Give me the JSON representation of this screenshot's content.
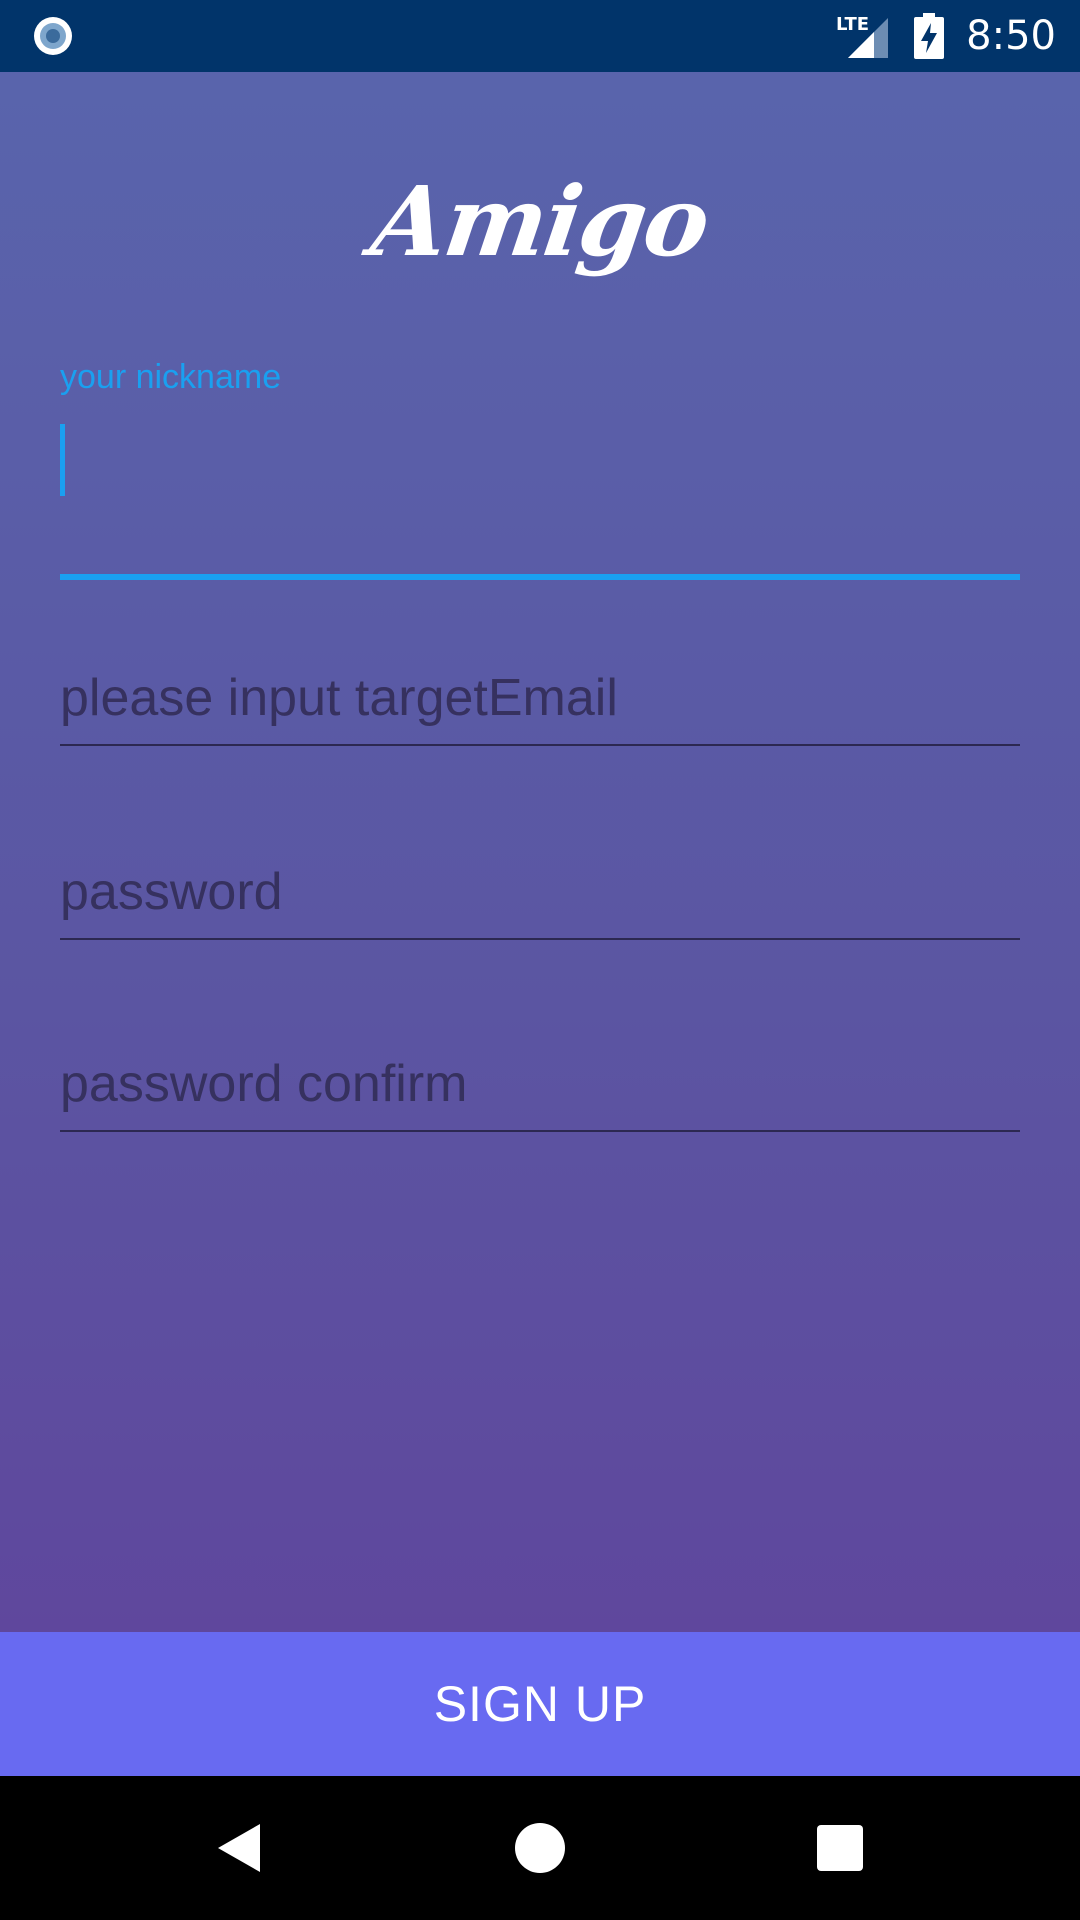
{
  "status_bar": {
    "time": "8:50",
    "network_label": "LTE",
    "icons": [
      "status-circle-icon",
      "lte-signal-icon",
      "battery-charging-icon"
    ],
    "background": "#01346a"
  },
  "app": {
    "logo_text": "Amigo"
  },
  "form": {
    "nickname": {
      "label": "your nickname",
      "value": ""
    },
    "target_email": {
      "placeholder": "please input targetEmail",
      "value": ""
    },
    "password": {
      "placeholder": "password",
      "value": ""
    },
    "password_confirm": {
      "placeholder": "password confirm",
      "value": ""
    }
  },
  "signup_button": {
    "label": "SIGN UP",
    "background": "#686af1"
  },
  "nav": {
    "icons": [
      "back-icon",
      "home-icon",
      "recents-icon"
    ]
  },
  "colors": {
    "accent": "#1aa0f0",
    "gradient_top": "#5964ac",
    "gradient_bottom": "#5f479d"
  }
}
